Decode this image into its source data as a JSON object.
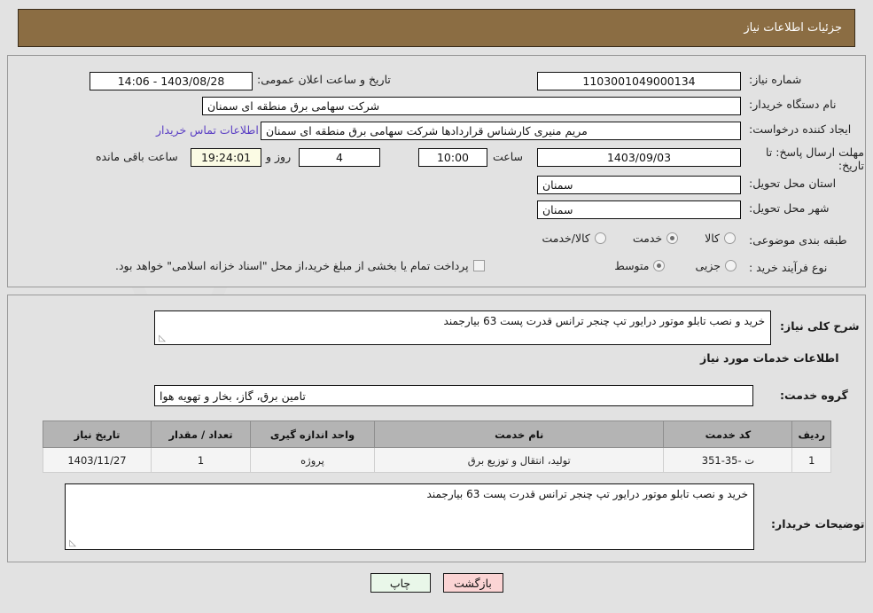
{
  "header": {
    "title": "جزئیات اطلاعات نیاز"
  },
  "watermark": {
    "text": "AriaTender.net"
  },
  "form": {
    "need_number": {
      "label": "شماره نیاز:",
      "value": "1103001049000134"
    },
    "announce_datetime": {
      "label": "تاریخ و ساعت اعلان عمومی:",
      "value": "1403/08/28 - 14:06"
    },
    "buyer_org": {
      "label": "نام دستگاه خریدار:",
      "value": "شرکت سهامی برق منطقه ای سمنان"
    },
    "requester": {
      "label": "ایجاد کننده درخواست:",
      "value": "مریم منیری کارشناس قراردادها شرکت سهامی برق منطقه ای سمنان"
    },
    "buyer_contact_link": "اطلاعات تماس خریدار",
    "deadline": {
      "label": "مهلت ارسال پاسخ: تا تاریخ:",
      "date": "1403/09/03",
      "time_label": "ساعت",
      "time": "10:00",
      "days": "4",
      "days_label": "روز و",
      "remaining": "19:24:01",
      "remaining_label": "ساعت باقی مانده"
    },
    "province": {
      "label": "استان محل تحویل:",
      "value": "سمنان"
    },
    "city": {
      "label": "شهر محل تحویل:",
      "value": "سمنان"
    },
    "category": {
      "label": "طبقه بندی موضوعی:",
      "options": [
        {
          "text": "کالا",
          "selected": false
        },
        {
          "text": "خدمت",
          "selected": true
        },
        {
          "text": "کالا/خدمت",
          "selected": false
        }
      ]
    },
    "purchase_type": {
      "label": "نوع فرآیند خرید :",
      "options": [
        {
          "text": "جزیی",
          "selected": false
        },
        {
          "text": "متوسط",
          "selected": true
        }
      ],
      "treasury_checkbox": {
        "checked": false,
        "text": "پرداخت تمام یا بخشی از مبلغ خرید،از محل \"اسناد خزانه اسلامی\" خواهد بود."
      }
    }
  },
  "need_summary": {
    "label": "شرح کلی نیاز:",
    "value": "خرید و نصب تابلو موتور درایور تپ چنجر ترانس قدرت پست 63 بیارجمند"
  },
  "services_section": {
    "heading": "اطلاعات خدمات مورد نیاز",
    "group_label": "گروه خدمت:",
    "group_value": "تامین برق، گاز، بخار و تهویه هوا"
  },
  "items_table": {
    "columns": [
      "ردیف",
      "کد خدمت",
      "نام خدمت",
      "واحد اندازه گیری",
      "تعداد / مقدار",
      "تاریخ نیاز"
    ],
    "rows": [
      {
        "index": "1",
        "code": "ت -35-351",
        "name": "تولید، انتقال و توزیع برق",
        "unit": "پروژه",
        "quantity": "1",
        "need_date": "1403/11/27"
      }
    ]
  },
  "buyer_notes": {
    "label": "توضیحات خریدار:",
    "value": "خرید و نصب تابلو موتور درایور تپ چنجر ترانس قدرت پست 63 بیارجمند"
  },
  "buttons": {
    "print": "چاپ",
    "back": "بازگشت"
  },
  "colors": {
    "header_brown": "#8b6d43",
    "page_bg": "#e2e2e2",
    "link_purple": "#5b3fc4",
    "table_header": "#b4b4b4",
    "btn_print": "#e9f7e9",
    "btn_back": "#fbd4d4"
  }
}
